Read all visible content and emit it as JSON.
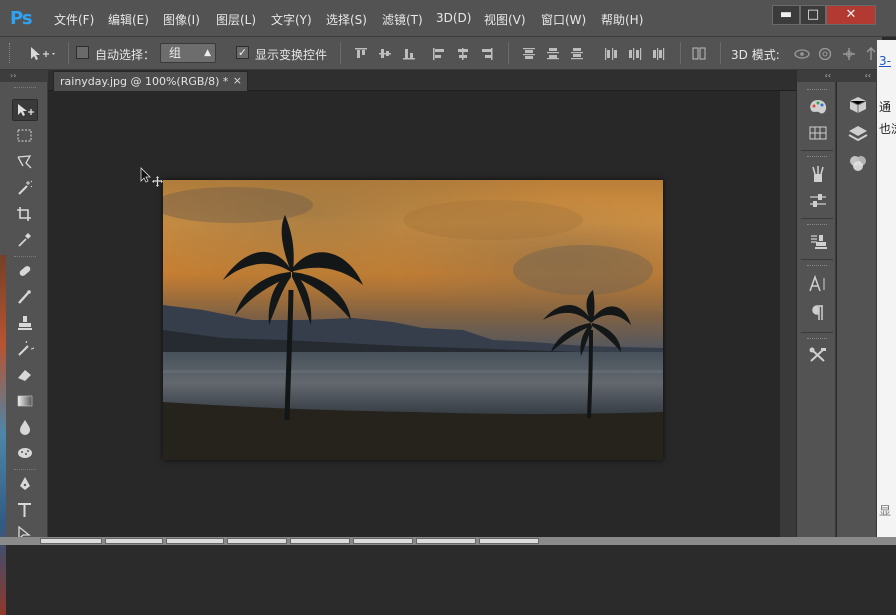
{
  "app": {
    "logo": "Ps"
  },
  "menu": [
    "文件(F)",
    "编辑(E)",
    "图像(I)",
    "图层(L)",
    "文字(Y)",
    "选择(S)",
    "滤镜(T)",
    "3D(D)",
    "视图(V)",
    "窗口(W)",
    "帮助(H)"
  ],
  "window_controls": {
    "minimize": "▬",
    "maximize": "□",
    "close": "✕"
  },
  "options": {
    "auto_select_label": "自动选择：",
    "auto_select_checked": false,
    "group_value": "组",
    "show_transform_label": "显示变换控件",
    "show_transform_checked": true,
    "mode_3d_label": "3D 模式:"
  },
  "document": {
    "tab_label": "rainyday.jpg @ 100%(RGB/8) *",
    "close_label": "×"
  },
  "toolbar": {
    "tools": [
      "move-tool",
      "rectangular-marquee-tool",
      "lasso-tool",
      "magic-wand-tool",
      "crop-tool",
      "eyedropper-tool",
      "spot-healing-brush-tool",
      "brush-tool",
      "clone-stamp-tool",
      "history-brush-tool",
      "eraser-tool",
      "gradient-tool",
      "blur-tool",
      "dodge-tool",
      "pen-tool",
      "type-tool",
      "path-selection-tool"
    ],
    "active": "move-tool"
  },
  "panels": {
    "col1": [
      "color-palette-icon",
      "swatches-grid-icon",
      "brush-presets-icon",
      "adjustments-sliders-icon",
      "clone-source-icon",
      "character-icon",
      "paragraph-icon",
      "tools-preset-icon"
    ],
    "col2": [
      "3d-cube-icon",
      "layers-icon",
      "channels-icon"
    ]
  },
  "background_app": {
    "fragments": [
      "3-",
      "通",
      "也浏"
    ],
    "bottom_fragment": "显"
  },
  "colors": {
    "chrome": "#535353",
    "canvas": "#282828",
    "accent": "#2fa3f3",
    "sky_top": "#e8a048",
    "sky_mid": "#d98a35"
  }
}
